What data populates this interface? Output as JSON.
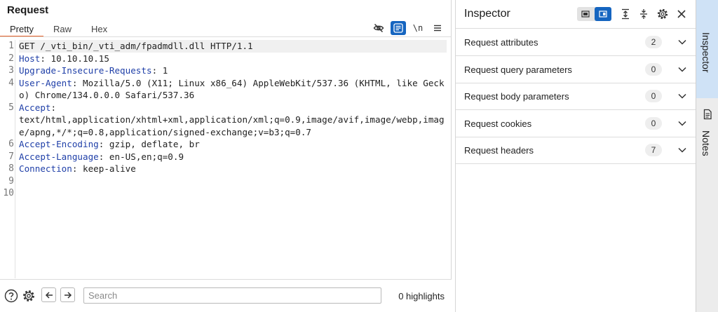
{
  "request": {
    "title": "Request",
    "tabs": [
      "Pretty",
      "Raw",
      "Hex"
    ],
    "active_tab": "Pretty",
    "toolbar": {
      "icons": [
        "eye-slash-icon",
        "wrap-icon",
        "newline-icon",
        "menu-icon"
      ],
      "newline_label": "\\n"
    },
    "line_numbers": [
      "1",
      "2",
      "3",
      "4",
      "5",
      "6",
      "7",
      "8",
      "9",
      "10"
    ],
    "lines": [
      {
        "name": "",
        "sep": "",
        "value": "GET /_vti_bin/_vti_adm/fpadmdll.dll HTTP/1.1"
      },
      {
        "name": "Host",
        "sep": ": ",
        "value": "10.10.10.15"
      },
      {
        "name": "Upgrade-Insecure-Requests",
        "sep": ": ",
        "value": "1"
      },
      {
        "name": "User-Agent",
        "sep": ": ",
        "value": "Mozilla/5.0 (X11; Linux x86_64) AppleWebKit/537.36 (KHTML, like Gecko) Chrome/134.0.0.0 Safari/537.36"
      },
      {
        "name": "Accept",
        "sep": ":",
        "value": "text/html,application/xhtml+xml,application/xml;q=0.9,image/avif,image/webp,image/apng,*/*;q=0.8,application/signed-exchange;v=b3;q=0.7"
      },
      {
        "name": "Accept-Encoding",
        "sep": ": ",
        "value": "gzip, deflate, br"
      },
      {
        "name": "Accept-Language",
        "sep": ": ",
        "value": "en-US,en;q=0.9"
      },
      {
        "name": "Connection",
        "sep": ": ",
        "value": "keep-alive"
      },
      {
        "name": "",
        "sep": "",
        "value": ""
      },
      {
        "name": "",
        "sep": "",
        "value": ""
      }
    ],
    "search": {
      "placeholder": "Search",
      "value": ""
    },
    "highlights": "0 highlights"
  },
  "inspector": {
    "title": "Inspector",
    "sections": [
      {
        "label": "Request attributes",
        "count": "2"
      },
      {
        "label": "Request query parameters",
        "count": "0"
      },
      {
        "label": "Request body parameters",
        "count": "0"
      },
      {
        "label": "Request cookies",
        "count": "0"
      },
      {
        "label": "Request headers",
        "count": "7"
      }
    ]
  },
  "side_tabs": [
    {
      "label": "Inspector",
      "active": true
    },
    {
      "label": "Notes",
      "active": false,
      "icon": "document-icon"
    }
  ],
  "colors": {
    "accent": "#1565c0",
    "tab_underline": "#e8632b",
    "header_name": "#1f3fa8",
    "side_tab_active": "#cfe2f6"
  }
}
